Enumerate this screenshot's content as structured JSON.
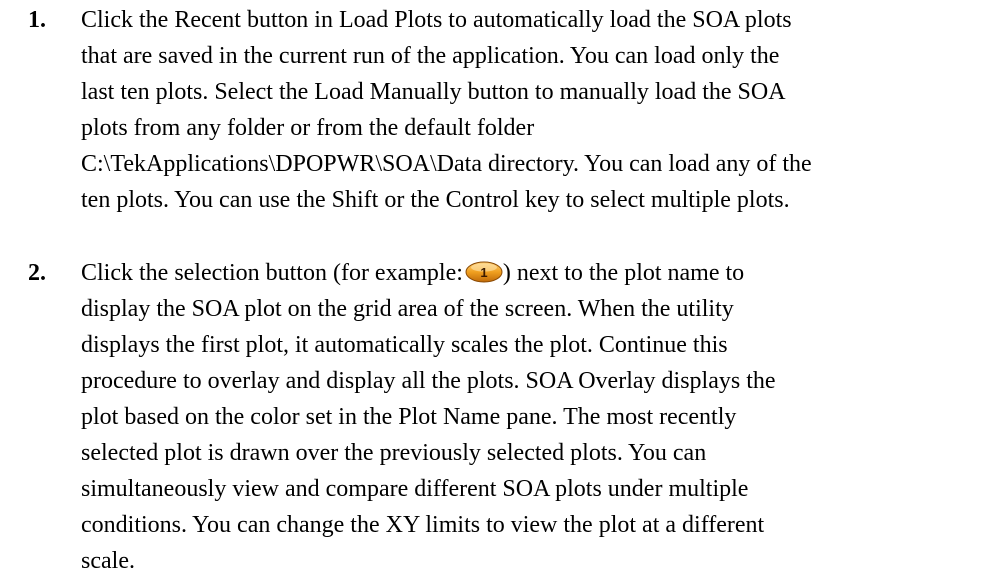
{
  "steps": [
    {
      "number": "1.",
      "lines": [
        "Click the Recent button in Load Plots to automatically load the SOA plots",
        "that are saved in the current run of the application. You can load only the",
        "last ten plots. Select the Load Manually button to manually load the SOA",
        "plots from any folder or from the default folder",
        "C:\\TekApplications\\DPOPWR\\SOA\\Data directory. You can load any of the",
        "ten plots. You can use the Shift or the Control key to select multiple plots."
      ]
    },
    {
      "number": "2.",
      "first_line_before_icon": "Click the selection button (for example:",
      "icon_label": "1",
      "icon_color": "#f0a020",
      "first_line_after_icon": ") next to the plot name to",
      "lines": [
        "display the SOA plot on the grid area of the screen. When the utility",
        "displays the first plot, it automatically scales the plot. Continue this",
        "procedure to overlay and display all the plots. SOA Overlay displays the",
        "plot based on the color set in the Plot Name pane. The most recently",
        "selected plot is drawn over the previously selected plots. You can",
        "simultaneously view and compare different SOA plots under multiple",
        "conditions. You can change the XY limits to view the plot at a different",
        "scale."
      ]
    }
  ]
}
